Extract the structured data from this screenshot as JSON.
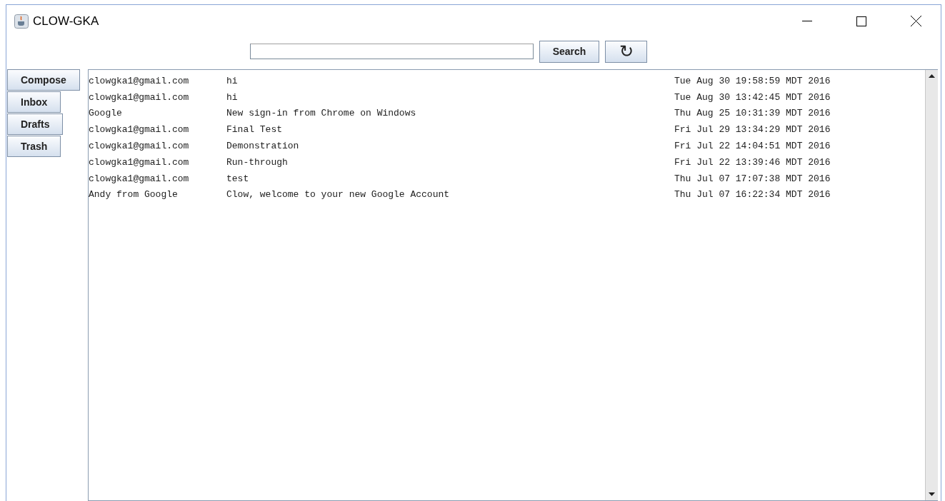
{
  "window": {
    "title": "CLOW-GKA"
  },
  "search": {
    "button": "Search",
    "refresh": "↻"
  },
  "nav": [
    {
      "label": "Compose"
    },
    {
      "label": "Inbox"
    },
    {
      "label": "Drafts"
    },
    {
      "label": "Trash"
    }
  ],
  "messages": [
    {
      "from": "clowgka1@gmail.com",
      "subject": "hi",
      "date": "Tue Aug 30 19:58:59 MDT 2016"
    },
    {
      "from": "clowgka1@gmail.com",
      "subject": "hi",
      "date": "Tue Aug 30 13:42:45 MDT 2016"
    },
    {
      "from": "Google",
      "subject": "New sign-in from Chrome on Windows",
      "date": "Thu Aug 25 10:31:39 MDT 2016"
    },
    {
      "from": "clowgka1@gmail.com",
      "subject": "Final Test",
      "date": "Fri Jul 29 13:34:29 MDT 2016"
    },
    {
      "from": "clowgka1@gmail.com",
      "subject": "Demonstration",
      "date": "Fri Jul 22 14:04:51 MDT 2016"
    },
    {
      "from": "clowgka1@gmail.com",
      "subject": "Run-through",
      "date": "Fri Jul 22 13:39:46 MDT 2016"
    },
    {
      "from": "clowgka1@gmail.com",
      "subject": "test",
      "date": "Thu Jul 07 17:07:38 MDT 2016"
    },
    {
      "from": "Andy from Google",
      "subject": "Clow, welcome to your new Google Account",
      "date": "Thu Jul 07 16:22:34 MDT 2016"
    }
  ]
}
